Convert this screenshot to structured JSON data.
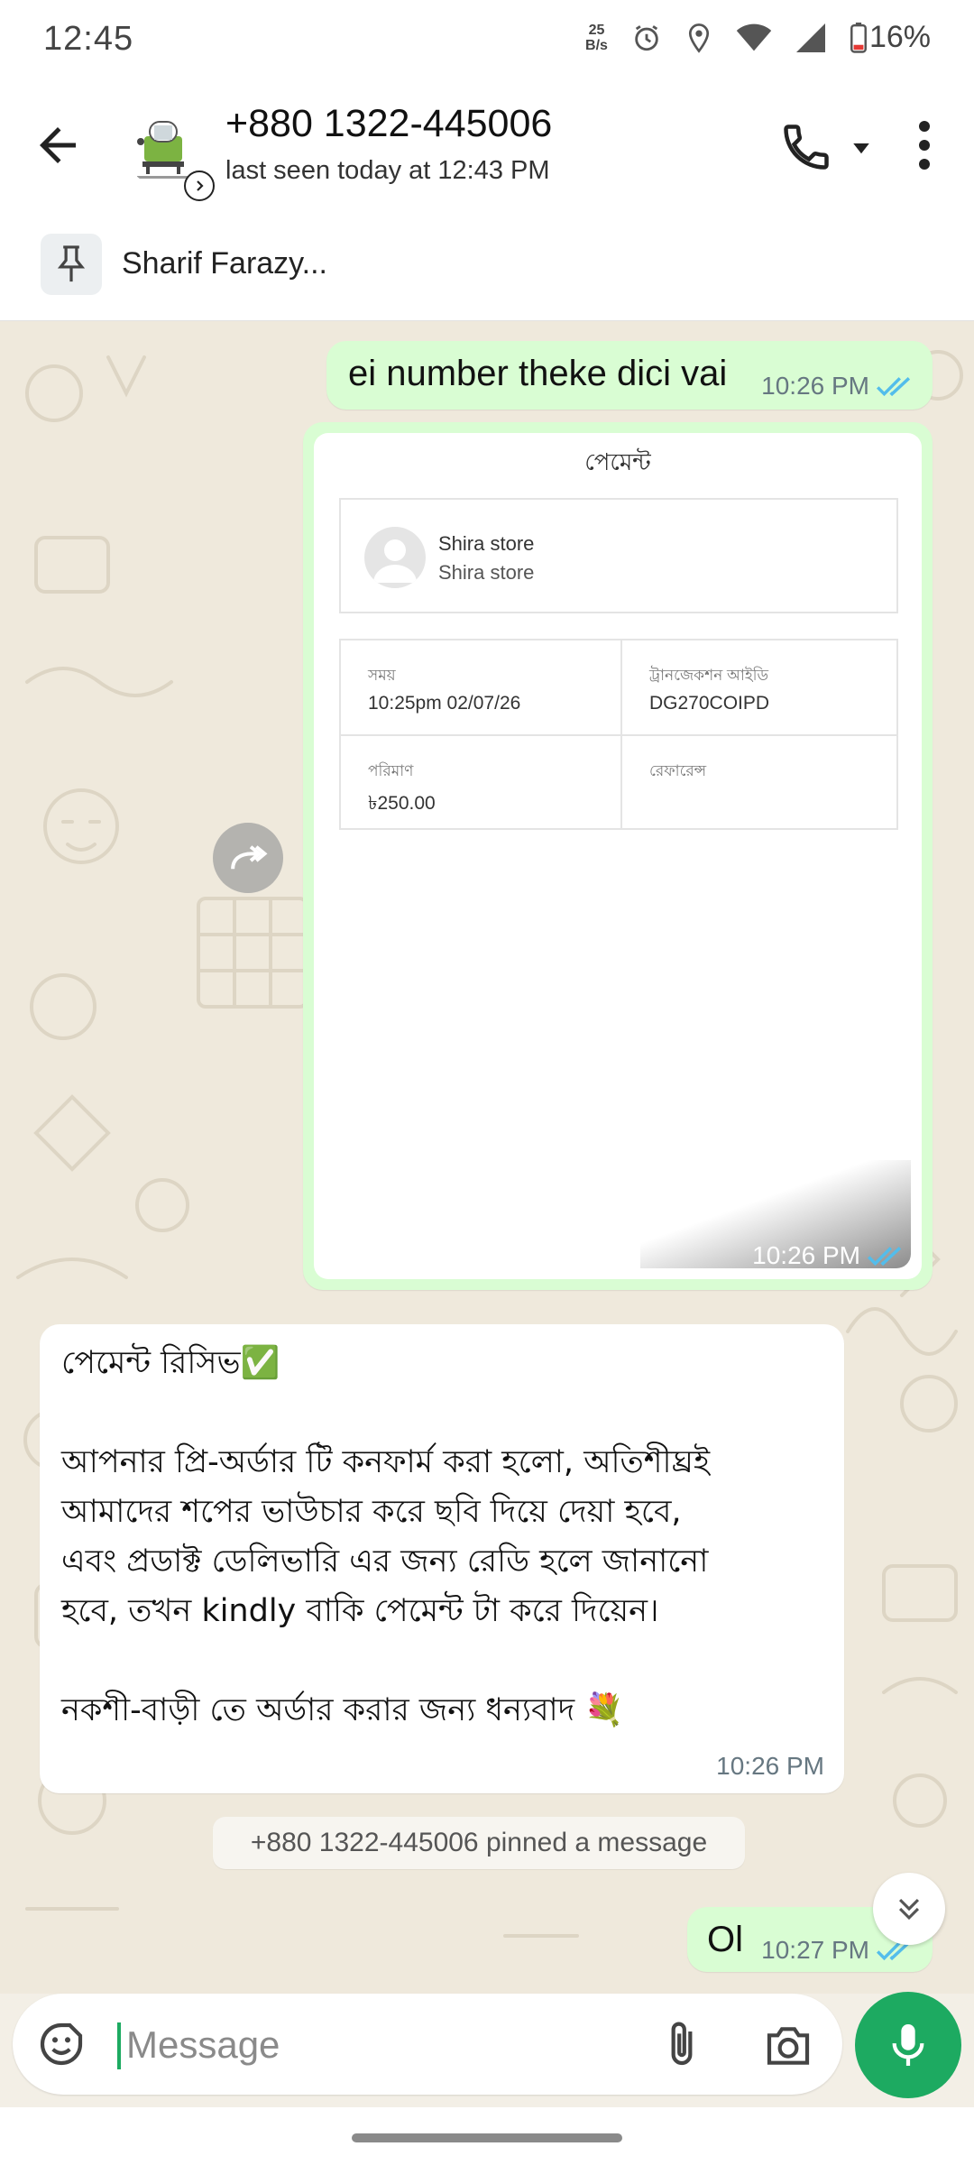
{
  "status_bar": {
    "time": "12:45",
    "net_speed_value": "25",
    "net_speed_unit": "B/s",
    "battery": "16%"
  },
  "header": {
    "contact_name": "+880 1322-445006",
    "contact_status": "last seen today at 12:43 PM"
  },
  "pinned": {
    "text": "Sharif Farazy..."
  },
  "messages": {
    "outgoing_1": {
      "text": "ei number theke dici vai",
      "time": "10:26 PM"
    },
    "receipt": {
      "title": "পেমেন্ট",
      "merchant_name": "Shira store",
      "merchant_sub": "Shira store",
      "time_label": "সময়",
      "time_value": "10:25pm 02/07/26",
      "txn_label": "ট্রানজেকশন আইডি",
      "txn_value": "DG270COIPD",
      "amount_label": "পরিমাণ",
      "amount_value": "৳250.00",
      "reference_label": "রেফারেন্স",
      "time": "10:26 PM"
    },
    "incoming_1": {
      "line_1": "পেমেন্ট রিসিভ✅",
      "line_2": "আপনার প্রি-অর্ডার টি কনফার্ম করা হলো, অতিশীঘ্রই",
      "line_3": "আমাদের শপের ভাউচার করে ছবি দিয়ে দেয়া হবে,",
      "line_4": "এবং প্রডাক্ট ডেলিভারি এর জন্য রেডি হলে জানানো",
      "line_5": "হবে, তখন kindly বাকি পেমেন্ট টা করে দিয়েন।",
      "line_6": "নকশী-বাড়ী তে অর্ডার করার জন্য ধন্যবাদ 💐",
      "time": "10:26 PM"
    },
    "system_notice": "+880 1322-445006 pinned a message",
    "outgoing_2": {
      "text": "Ol",
      "time": "10:27 PM"
    }
  },
  "composer": {
    "placeholder": "Message"
  },
  "colors": {
    "accent_green": "#1daa61",
    "outgoing_bubble": "#d9fdd3",
    "read_ticks": "#53bdeb",
    "chat_background": "#efe9dc"
  },
  "icons": [
    "back-arrow-icon",
    "call-icon",
    "chevron-down-icon",
    "more-vert-icon",
    "pin-icon",
    "forward-icon",
    "double-check-icon",
    "sticker-icon",
    "attach-icon",
    "camera-icon",
    "mic-icon",
    "scroll-down-icon"
  ]
}
